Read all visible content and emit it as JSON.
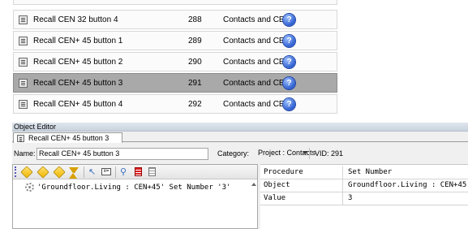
{
  "list": {
    "rows": [
      {
        "name": "Recall CEN 32 button 4",
        "number": "288",
        "category": "Contacts and CE",
        "help": "?",
        "selected": false
      },
      {
        "name": "Recall CEN+ 45 button 1",
        "number": "289",
        "category": "Contacts and CE",
        "help": "?",
        "selected": false
      },
      {
        "name": "Recall CEN+ 45 button 2",
        "number": "290",
        "category": "Contacts and CE",
        "help": "?",
        "selected": false
      },
      {
        "name": "Recall CEN+ 45 button 3",
        "number": "291",
        "category": "Contacts and CE",
        "help": "?",
        "selected": true
      },
      {
        "name": "Recall CEN+ 45 button 4",
        "number": "292",
        "category": "Contacts and CE",
        "help": "?",
        "selected": false
      }
    ]
  },
  "editor": {
    "title": "Object Editor",
    "tab_label": "Recall CEN+ 45 button 3",
    "name_label": "Name:",
    "name_value": "Recall CEN+ 45 button 3",
    "category_label": "Category:",
    "category_value": "Project : Contacts",
    "vid_text": "VID: 291"
  },
  "action": {
    "item_text": "'Groundfloor.Living : CEN+45' Set Number '3'"
  },
  "properties": [
    {
      "key": "Procedure",
      "value": "Set Number"
    },
    {
      "key": "Object",
      "value": "Groundfloor.Living : CEN+45"
    },
    {
      "key": "Value",
      "value": "3"
    }
  ],
  "colors": {
    "selected_row": "#a9a9a9",
    "help_icon": "#2f5fd0",
    "toolbar_diamond": "#f1b500"
  }
}
